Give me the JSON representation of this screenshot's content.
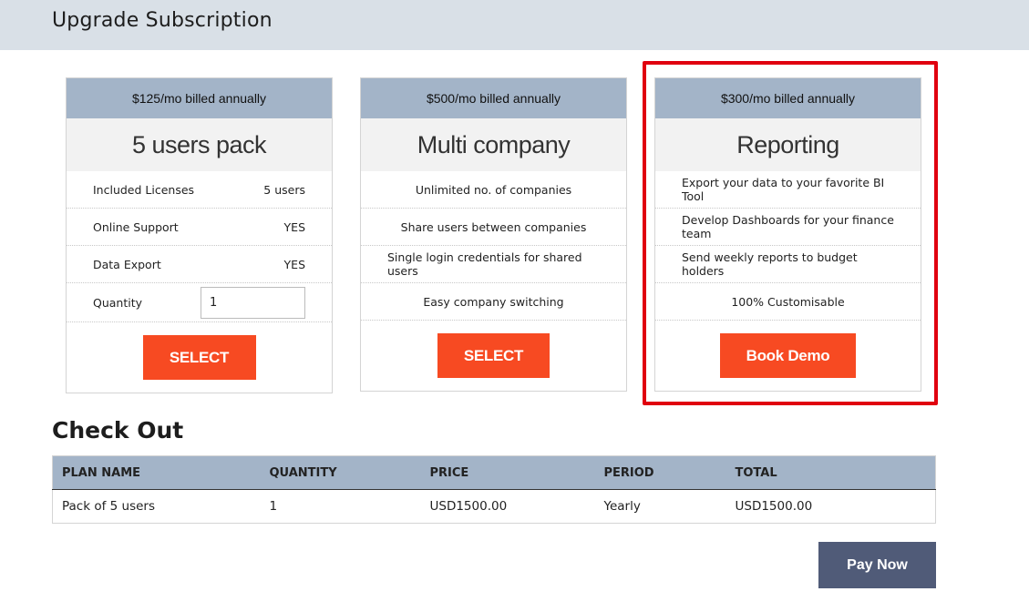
{
  "header": {
    "title": "Upgrade Subscription"
  },
  "plans": [
    {
      "price": "$125/mo billed annually",
      "name": "5 users pack",
      "features": [
        {
          "label": "Included Licenses",
          "value": "5 users"
        },
        {
          "label": "Online Support",
          "value": "YES"
        },
        {
          "label": "Data Export",
          "value": "YES"
        }
      ],
      "quantity_label": "Quantity",
      "quantity_value": "1",
      "button_label": "SELECT"
    },
    {
      "price": "$500/mo billed annually",
      "name": "Multi company",
      "features": [
        "Unlimited no. of companies",
        "Share users between companies",
        "Single login credentials for shared users",
        "Easy company switching"
      ],
      "button_label": "SELECT"
    },
    {
      "price": "$300/mo billed annually",
      "name": "Reporting",
      "features": [
        "Export your data to your favorite BI Tool",
        "Develop Dashboards for your finance team",
        "Send weekly reports to budget holders",
        "100% Customisable"
      ],
      "button_label": "Book Demo",
      "highlighted": true
    }
  ],
  "checkout": {
    "title": "Check Out",
    "columns": [
      "PLAN NAME",
      "QUANTITY",
      "PRICE",
      "PERIOD",
      "TOTAL"
    ],
    "rows": [
      [
        "Pack of 5 users",
        "1",
        "USD1500.00",
        "Yearly",
        "USD1500.00"
      ]
    ],
    "pay_button": "Pay Now"
  },
  "colors": {
    "accent": "#f74a22",
    "header_band": "#a3b4c8",
    "pay_button": "#505b78",
    "highlight": "#e0000f"
  }
}
